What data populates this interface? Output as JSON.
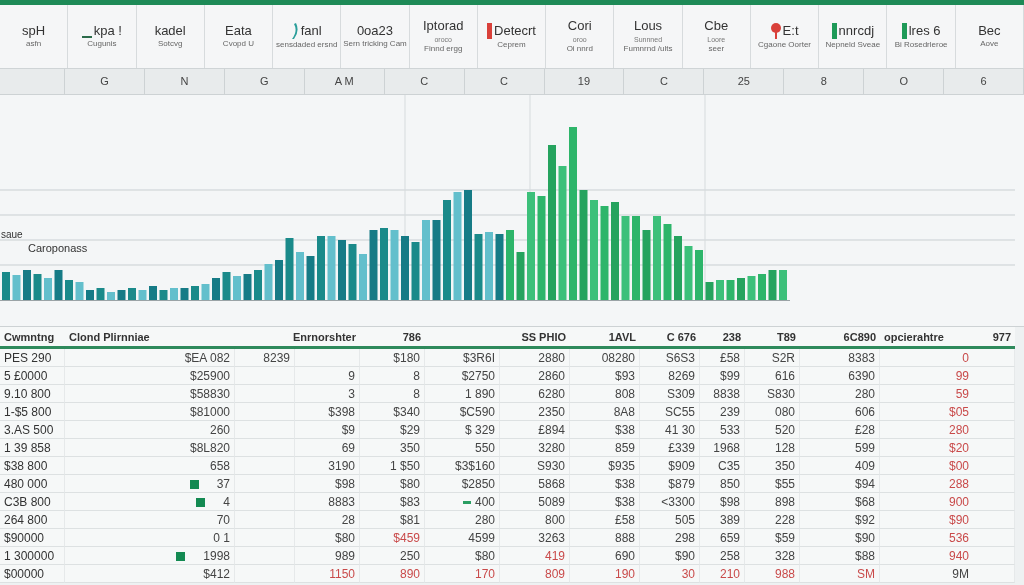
{
  "ribbon": [
    {
      "title": "spH",
      "caption": "asfn"
    },
    {
      "title": "kpa !",
      "caption": "Cugunis"
    },
    {
      "title": "kadel",
      "caption": "Sotcvg"
    },
    {
      "title": "Eata",
      "caption": "Cvopd U"
    },
    {
      "title": "fanl",
      "caption": "sensdaded ersnd"
    },
    {
      "title": "0oa23",
      "caption": "Sern tricking Cam"
    },
    {
      "title": "Iptorad",
      "caption": "Finnd  ergg",
      "sub": "oroco"
    },
    {
      "title": "Detecrt",
      "caption": "Ceprem"
    },
    {
      "title": "Cori",
      "caption": "Oi nnrd",
      "sub": "oroo"
    },
    {
      "title": "Lous",
      "caption": "Fumnrnd  /ults",
      "sub": "Sunnned"
    },
    {
      "title": "Cbe",
      "caption": "seer",
      "sub": "Loore"
    },
    {
      "title": "E:t",
      "caption": "Cgaone Oorter"
    },
    {
      "title": "nnrcdj",
      "caption": "Nepneld Sveae"
    },
    {
      "title": "lres 6",
      "caption": "Bi Rosedrleroe"
    },
    {
      "title": "Bec",
      "caption": "Aove"
    }
  ],
  "column_letters": [
    "G",
    "N",
    "G",
    "A M",
    "C",
    "C",
    "19",
    "C",
    "25",
    "8",
    "O",
    "6"
  ],
  "chart": {
    "title": "saue",
    "series_label": "Caroponass"
  },
  "table": {
    "header": [
      "Cwmntng",
      "Clond Plirnniae",
      "Enrnorshter",
      "786",
      "SS PHIO",
      "1AVL",
      "C 676",
      "238",
      "T89",
      "6C890",
      "opcierahtre",
      "977"
    ],
    "rows": [
      {
        "cells": [
          {
            "text": "PES 290",
            "negative": false
          },
          {
            "text": "$EA 082",
            "negative": false
          },
          {
            "text": "8239",
            "negative": false
          },
          null,
          {
            "text": "$180",
            "negative": false
          },
          {
            "text": "$3R6I",
            "negative": false
          },
          {
            "text": "2880",
            "negative": false
          },
          {
            "text": "08280",
            "negative": false
          },
          {
            "text": "S6S3",
            "negative": false
          },
          {
            "text": "£58",
            "negative": false
          },
          {
            "text": "S2R",
            "negative": false
          },
          {
            "text": "8383",
            "negative": false
          },
          {
            "text": "0",
            "negative": true
          }
        ]
      },
      {
        "cells": [
          {
            "text": "5 £0000",
            "negative": false
          },
          {
            "text": "$25900",
            "negative": false
          },
          null,
          {
            "text": "9",
            "negative": false
          },
          {
            "text": "8",
            "negative": false
          },
          {
            "text": "$2750",
            "negative": false
          },
          {
            "text": "2860",
            "negative": false
          },
          {
            "text": "$93",
            "negative": false
          },
          {
            "text": "8269",
            "negative": false
          },
          {
            "text": "$99",
            "negative": false
          },
          {
            "text": "616",
            "negative": false
          },
          {
            "text": "6390",
            "negative": false
          },
          {
            "text": "99",
            "negative": true
          }
        ]
      },
      {
        "cells": [
          {
            "text": "9.10 800",
            "negative": false
          },
          {
            "text": "$58830",
            "negative": false
          },
          null,
          {
            "text": "3",
            "negative": false
          },
          {
            "text": "8",
            "negative": false
          },
          {
            "text": "1 890",
            "negative": false
          },
          {
            "text": "6280",
            "negative": false
          },
          {
            "text": "808",
            "negative": false
          },
          {
            "text": "S309",
            "negative": false
          },
          {
            "text": "8838",
            "negative": false
          },
          {
            "text": "S830",
            "negative": false
          },
          {
            "text": "280",
            "negative": false
          },
          {
            "text": "59",
            "negative": true
          }
        ]
      },
      {
        "cells": [
          {
            "text": "1-$5 800",
            "negative": false
          },
          {
            "text": "$81000",
            "negative": false
          },
          null,
          {
            "text": "$398",
            "negative": false
          },
          {
            "text": "$340",
            "negative": false
          },
          {
            "text": "$C590",
            "negative": false
          },
          {
            "text": "2350",
            "negative": false
          },
          {
            "text": "8A8",
            "negative": false
          },
          {
            "text": "SC55",
            "negative": false
          },
          {
            "text": "239",
            "negative": false
          },
          {
            "text": "080",
            "negative": false
          },
          {
            "text": "606",
            "negative": false
          },
          {
            "text": "$05",
            "negative": true
          }
        ]
      },
      {
        "cells": [
          {
            "text": "3.AS 500",
            "negative": false
          },
          {
            "text": "260",
            "negative": false
          },
          null,
          {
            "text": "$9",
            "negative": false
          },
          {
            "text": "$29",
            "negative": false
          },
          {
            "text": "$ 329",
            "negative": false
          },
          {
            "text": "£894",
            "negative": false
          },
          {
            "text": "$38",
            "negative": false
          },
          {
            "text": "41 30",
            "negative": false
          },
          {
            "text": "533",
            "negative": false
          },
          {
            "text": "520",
            "negative": false
          },
          {
            "text": "£28",
            "negative": false
          },
          {
            "text": "280",
            "negative": true
          }
        ]
      },
      {
        "cells": [
          {
            "text": "1 39 858",
            "negative": false
          },
          {
            "text": "$8L820",
            "negative": false
          },
          null,
          {
            "text": "69",
            "negative": false
          },
          {
            "text": "350",
            "negative": false
          },
          {
            "text": "550",
            "negative": false
          },
          {
            "text": "3280",
            "negative": false
          },
          {
            "text": "859",
            "negative": false
          },
          {
            "text": "£339",
            "negative": false
          },
          {
            "text": "1968",
            "negative": false
          },
          {
            "text": "128",
            "negative": false
          },
          {
            "text": "599",
            "negative": false
          },
          {
            "text": "$20",
            "negative": true
          }
        ]
      },
      {
        "cells": [
          {
            "text": "$38 800",
            "negative": false
          },
          {
            "text": "658",
            "negative": false
          },
          null,
          {
            "text": "3190",
            "negative": false
          },
          {
            "text": "1 $50",
            "negative": false
          },
          {
            "text": "$3$160",
            "negative": false
          },
          {
            "text": "S930",
            "negative": false
          },
          {
            "text": "$935",
            "negative": false
          },
          {
            "text": "$909",
            "negative": false
          },
          {
            "text": "C35",
            "negative": false
          },
          {
            "text": "350",
            "negative": false
          },
          {
            "text": "409",
            "negative": false
          },
          {
            "text": "$00",
            "negative": true
          }
        ]
      },
      {
        "cells": [
          {
            "text": "480 000",
            "negative": false
          },
          {
            "text": "37",
            "negative": false,
            "marker": true
          },
          null,
          {
            "text": "$98",
            "negative": false
          },
          {
            "text": "$80",
            "negative": false
          },
          {
            "text": "$2850",
            "negative": false
          },
          {
            "text": "5868",
            "negative": false
          },
          {
            "text": "$38",
            "negative": false
          },
          {
            "text": "$879",
            "negative": false
          },
          {
            "text": "850",
            "negative": false
          },
          {
            "text": "$55",
            "negative": false
          },
          {
            "text": "$94",
            "negative": false
          },
          {
            "text": "288",
            "negative": true
          }
        ]
      },
      {
        "cells": [
          {
            "text": "C3B 800",
            "negative": false
          },
          {
            "text": "4",
            "negative": false,
            "marker": true
          },
          null,
          {
            "text": "8883",
            "negative": false
          },
          {
            "text": "$83",
            "negative": false
          },
          {
            "text": "400",
            "negative": false,
            "dash": true
          },
          {
            "text": "5089",
            "negative": false
          },
          {
            "text": "$38",
            "negative": false
          },
          {
            "text": "<3300",
            "negative": false
          },
          {
            "text": "$98",
            "negative": false
          },
          {
            "text": "898",
            "negative": false
          },
          {
            "text": "$68",
            "negative": false
          },
          {
            "text": "900",
            "negative": true
          }
        ]
      },
      {
        "cells": [
          {
            "text": "264 800",
            "negative": false
          },
          {
            "text": "70",
            "negative": false
          },
          null,
          {
            "text": "28",
            "negative": false
          },
          {
            "text": "$81",
            "negative": false
          },
          {
            "text": "280",
            "negative": false
          },
          {
            "text": "800",
            "negative": false
          },
          {
            "text": "£58",
            "negative": false
          },
          {
            "text": "505",
            "negative": false
          },
          {
            "text": "389",
            "negative": false
          },
          {
            "text": "228",
            "negative": false
          },
          {
            "text": "$92",
            "negative": false
          },
          {
            "text": "$90",
            "negative": true
          }
        ]
      },
      {
        "cells": [
          {
            "text": "$90000",
            "negative": false
          },
          {
            "text": "0 1",
            "negative": false
          },
          null,
          {
            "text": "$80",
            "negative": false
          },
          {
            "text": "$459",
            "negative": true
          },
          {
            "text": "4599",
            "negative": false
          },
          {
            "text": "3263",
            "negative": false
          },
          {
            "text": "888",
            "negative": false
          },
          {
            "text": "298",
            "negative": false
          },
          {
            "text": "659",
            "negative": false
          },
          {
            "text": "$59",
            "negative": false
          },
          {
            "text": "$90",
            "negative": false
          },
          {
            "text": "536",
            "negative": true
          }
        ]
      },
      {
        "cells": [
          {
            "text": "1 300000",
            "negative": false
          },
          {
            "text": "1998",
            "negative": false,
            "marker": true
          },
          null,
          {
            "text": "989",
            "negative": false
          },
          {
            "text": "250",
            "negative": false
          },
          {
            "text": "$80",
            "negative": false
          },
          {
            "text": "419",
            "negative": true
          },
          {
            "text": "690",
            "negative": false
          },
          {
            "text": "$90",
            "negative": false
          },
          {
            "text": "258",
            "negative": false
          },
          {
            "text": "328",
            "negative": false
          },
          {
            "text": "$88",
            "negative": false
          },
          {
            "text": "940",
            "negative": true
          }
        ]
      },
      {
        "cells": [
          {
            "text": "$00000",
            "negative": false
          },
          {
            "text": "$412",
            "negative": false
          },
          null,
          {
            "text": "1150",
            "negative": true
          },
          {
            "text": "890",
            "negative": true
          },
          {
            "text": "170",
            "negative": true
          },
          {
            "text": "809",
            "negative": true
          },
          {
            "text": "190",
            "negative": true
          },
          {
            "text": "30",
            "negative": true
          },
          {
            "text": "210",
            "negative": true
          },
          {
            "text": "988",
            "negative": true
          },
          {
            "text": "SM",
            "negative": true
          },
          {
            "text": "9M",
            "negative": false
          }
        ]
      }
    ]
  }
}
